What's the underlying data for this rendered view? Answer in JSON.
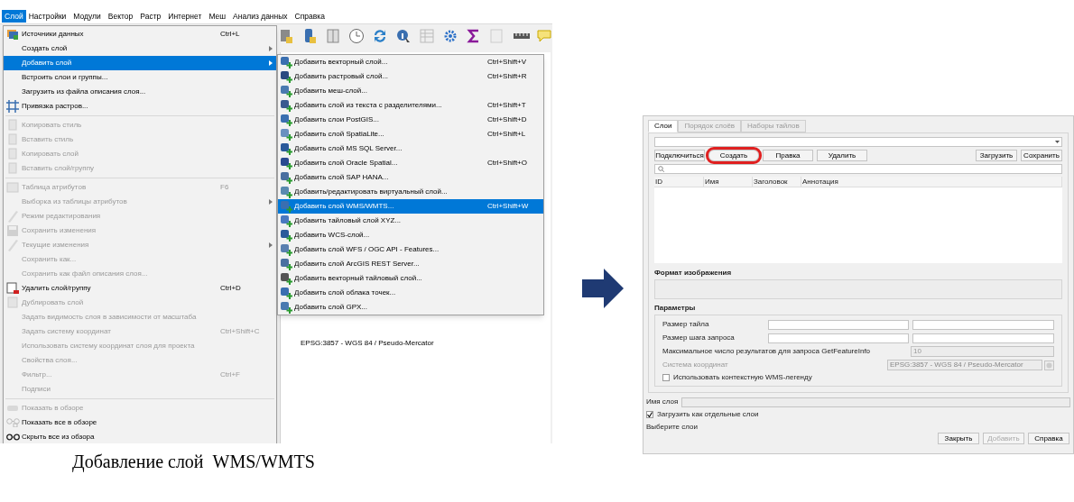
{
  "qgis_window": {
    "menubar": [
      {
        "label": "Слой",
        "selected": true
      },
      {
        "label": "Настройки",
        "selected": false
      },
      {
        "label": "Модули",
        "selected": false
      },
      {
        "label": "Вектор",
        "selected": false
      },
      {
        "label": "Растр",
        "selected": false
      },
      {
        "label": "Интернет",
        "selected": false
      },
      {
        "label": "Меш",
        "selected": false
      },
      {
        "label": "Анализ данных",
        "selected": false
      },
      {
        "label": "Справка",
        "selected": false
      }
    ],
    "layer_menu": {
      "sections": [
        [
          {
            "label": "Источники данных",
            "shortcut": "Ctrl+L",
            "disabled": false,
            "selected": false,
            "has_submenu": false
          },
          {
            "label": "Создать слой",
            "disabled": false,
            "selected": false,
            "has_submenu": true
          },
          {
            "label": "Добавить слой",
            "disabled": false,
            "selected": true,
            "has_submenu": true
          },
          {
            "label": "Встроить слои и группы...",
            "disabled": false,
            "selected": false,
            "has_submenu": false
          },
          {
            "label": "Загрузить из файла описания слоя...",
            "disabled": false,
            "selected": false,
            "has_submenu": false
          },
          {
            "label": "Привязка растров...",
            "disabled": false,
            "selected": false,
            "has_submenu": false
          }
        ],
        [
          {
            "label": "Копировать стиль",
            "disabled": true,
            "selected": false,
            "has_submenu": false
          },
          {
            "label": "Вставить стиль",
            "disabled": true,
            "selected": false,
            "has_submenu": false
          },
          {
            "label": "Копировать слой",
            "disabled": true,
            "selected": false,
            "has_submenu": false
          },
          {
            "label": "Вставить слой/группу",
            "disabled": true,
            "selected": false,
            "has_submenu": false
          }
        ],
        [
          {
            "label": "Таблица атрибутов",
            "shortcut": "F6",
            "disabled": true,
            "selected": false,
            "has_submenu": false
          },
          {
            "label": "Выборка из таблицы атрибутов",
            "disabled": true,
            "selected": false,
            "has_submenu": true
          },
          {
            "label": "Режим редактирования",
            "disabled": true,
            "selected": false,
            "has_submenu": false
          },
          {
            "label": "Сохранить изменения",
            "disabled": true,
            "selected": false,
            "has_submenu": false
          },
          {
            "label": "Текущие изменения",
            "disabled": true,
            "selected": false,
            "has_submenu": true
          },
          {
            "label": "Сохранить как...",
            "disabled": true,
            "selected": false,
            "has_submenu": false
          },
          {
            "label": "Сохранить как файл описания слоя...",
            "disabled": true,
            "selected": false,
            "has_submenu": false
          },
          {
            "label": "Удалить слой/группу",
            "shortcut": "Ctrl+D",
            "disabled": false,
            "selected": false,
            "has_submenu": false
          },
          {
            "label": "Дублировать слой",
            "disabled": true,
            "selected": false,
            "has_submenu": false
          },
          {
            "label": "Задать видимость слоя в зависимости от масштаба",
            "disabled": true,
            "selected": false,
            "has_submenu": false
          },
          {
            "label": "Задать систему координат",
            "shortcut": "Ctrl+Shift+C",
            "disabled": true,
            "selected": false,
            "has_submenu": false
          },
          {
            "label": "Использовать систему координат слоя для проекта",
            "disabled": true,
            "selected": false,
            "has_submenu": false
          },
          {
            "label": "Свойства слоя...",
            "disabled": true,
            "selected": false,
            "has_submenu": false
          },
          {
            "label": "Фильтр...",
            "shortcut": "Ctrl+F",
            "disabled": true,
            "selected": false,
            "has_submenu": false
          },
          {
            "label": "Подписи",
            "disabled": true,
            "selected": false,
            "has_submenu": false
          }
        ],
        [
          {
            "label": "Показать в обзоре",
            "disabled": true,
            "selected": false,
            "has_submenu": false
          },
          {
            "label": "Показать все в обзоре",
            "disabled": false,
            "selected": false,
            "has_submenu": false
          },
          {
            "label": "Скрыть все из обзора",
            "disabled": false,
            "selected": false,
            "has_submenu": false
          }
        ]
      ]
    },
    "add_layer_submenu": [
      {
        "label": "Добавить векторный слой...",
        "shortcut": "Ctrl+Shift+V",
        "selected": false
      },
      {
        "label": "Добавить растровый слой...",
        "shortcut": "Ctrl+Shift+R",
        "selected": false
      },
      {
        "label": "Добавить меш-слой...",
        "selected": false
      },
      {
        "label": "Добавить слой из текста с разделителями...",
        "shortcut": "Ctrl+Shift+T",
        "selected": false
      },
      {
        "label": "Добавить слои PostGIS...",
        "shortcut": "Ctrl+Shift+D",
        "selected": false
      },
      {
        "label": "Добавить слой SpatiaLite...",
        "shortcut": "Ctrl+Shift+L",
        "selected": false
      },
      {
        "label": "Добавить слой MS SQL Server...",
        "selected": false
      },
      {
        "label": "Добавить слой Oracle Spatial...",
        "shortcut": "Ctrl+Shift+O",
        "selected": false
      },
      {
        "label": "Добавить слой SAP HANA...",
        "selected": false
      },
      {
        "label": "Добавить/редактировать виртуальный слой...",
        "selected": false
      },
      {
        "label": "Добавить слой WMS/WMTS...",
        "shortcut": "Ctrl+Shift+W",
        "selected": true
      },
      {
        "label": "Добавить тайловый слой XYZ...",
        "selected": false
      },
      {
        "label": "Добавить WCS-слой...",
        "selected": false
      },
      {
        "label": "Добавить слой WFS / OGC API - Features...",
        "selected": false
      },
      {
        "label": "Добавить слой ArcGIS REST Server...",
        "selected": false
      },
      {
        "label": "Добавить векторный тайловый слой...",
        "selected": false
      },
      {
        "label": "Добавить слой облака точек...",
        "selected": false
      },
      {
        "label": "Добавить слой GPX...",
        "selected": false
      }
    ],
    "project_crs": "EPSG:3857 - WGS 84 / Pseudo-Mercator"
  },
  "caption": "Добавление слой  WMS/WMTS",
  "wms_dialog": {
    "tabs": [
      {
        "label": "Слои",
        "selected": true
      },
      {
        "label": "Порядок слоёв",
        "selected": false
      },
      {
        "label": "Наборы тайлов",
        "selected": false
      }
    ],
    "connection_buttons": [
      {
        "label": "Подключиться",
        "circled": false
      },
      {
        "label": "Создать",
        "circled": true
      },
      {
        "label": "Правка",
        "circled": false
      },
      {
        "label": "Удалить",
        "circled": false
      }
    ],
    "file_buttons": [
      "Загрузить",
      "Сохранить"
    ],
    "table": {
      "columns": [
        "ID",
        "Имя",
        "Заголовок",
        "Аннотация"
      ]
    },
    "image_format_title": "Формат изображения",
    "parameters": {
      "title": "Параметры",
      "tile_size": {
        "label": "Размер тайла"
      },
      "request_step": {
        "label": "Размер шага запроса"
      },
      "max_results": {
        "label": "Максимальное число результатов для запроса GetFeatureInfo",
        "value": "10",
        "disabled": true
      },
      "crs": {
        "label": "Система координат",
        "value": "EPSG:3857 - WGS 84 / Pseudo-Mercator",
        "disabled": true
      },
      "contextual_legend": {
        "label": "Использовать контекстную WMS-легенду",
        "checked": false
      }
    },
    "layer_name_label": "Имя слоя",
    "load_separately": {
      "label": "Загрузить как отдельные слои",
      "checked": true
    },
    "select_layers_label": "Выберите слои",
    "footer_buttons": [
      {
        "label": "Закрыть",
        "disabled": false
      },
      {
        "label": "Добавить",
        "disabled": true
      },
      {
        "label": "Справка",
        "disabled": false
      }
    ]
  }
}
